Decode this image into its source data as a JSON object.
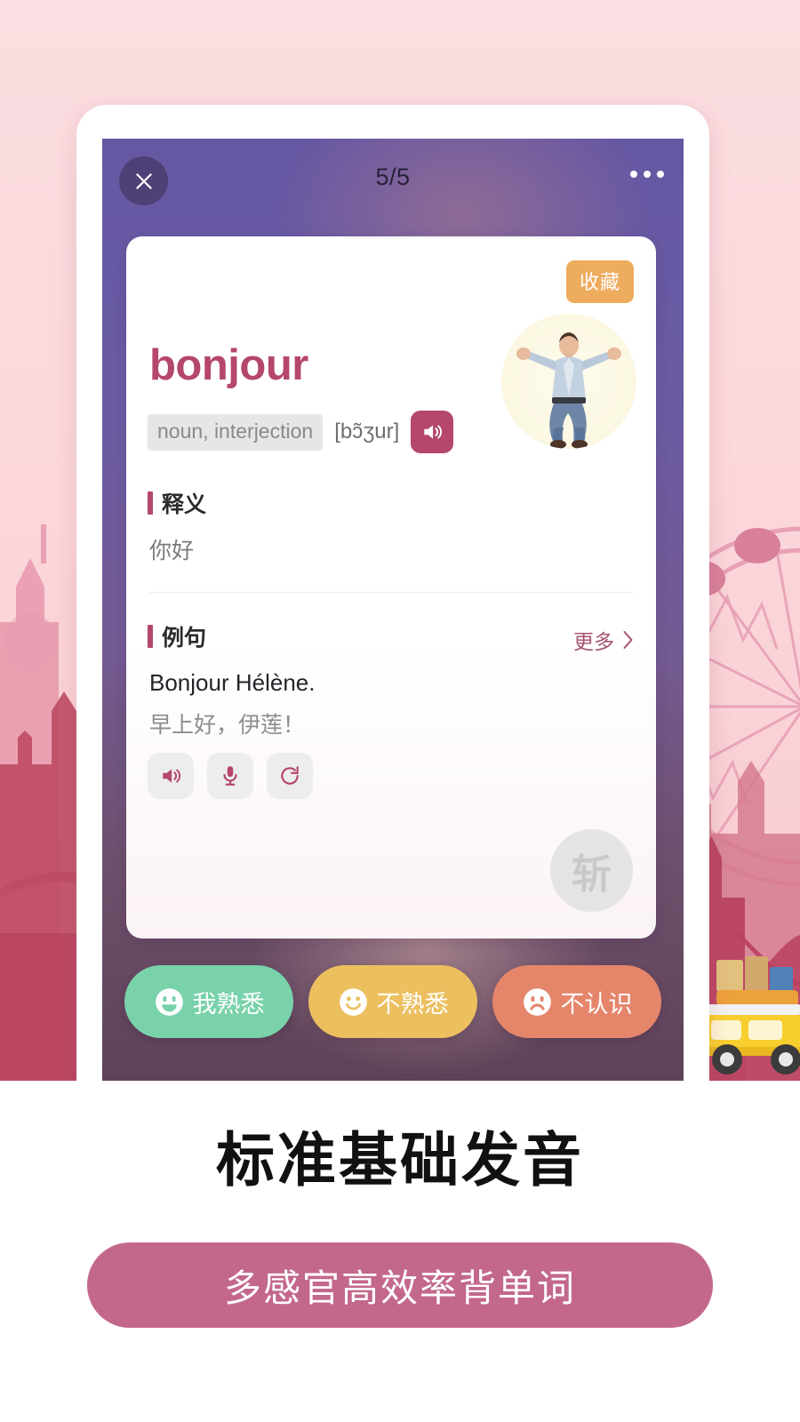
{
  "theme": {
    "page_bg": "#fbdee1",
    "screen_gradient_top": "#6657a3",
    "screen_gradient_bottom": "#5f4258",
    "accent": "#b5476a",
    "badge_orange": "#eeac5e",
    "cta_pink": "#c3688c"
  },
  "appbar": {
    "close_icon": "close-icon",
    "counter": "5/5",
    "more_icon": "more-options-icon"
  },
  "card": {
    "favorite_label": "收藏",
    "avatar_icon": "man-arms-open-illustration",
    "word": "bonjour",
    "part_of_speech": "noun, interjection",
    "phonetic": "[bɔ̃ʒur]",
    "speak_icon": "speaker-icon",
    "definition": {
      "heading": "释义",
      "text": "你好"
    },
    "examples": {
      "heading": "例句",
      "more_label": "更多",
      "more_icon": "chevron-right-icon",
      "source": "Bonjour Hélène.",
      "translation": "早上好，伊莲！",
      "actions": [
        {
          "name": "play-audio-button",
          "icon": "speaker-icon"
        },
        {
          "name": "record-button",
          "icon": "microphone-icon"
        },
        {
          "name": "replay-button",
          "icon": "refresh-icon"
        }
      ]
    },
    "watermark": "斩"
  },
  "answers": [
    {
      "label": "我熟悉",
      "icon": "smiley-grin-icon",
      "color": "#79d2aa",
      "name": "answer-familiar-button"
    },
    {
      "label": "不熟悉",
      "icon": "smiley-neutral-icon",
      "color": "#ecbf5f",
      "name": "answer-unfamiliar-button"
    },
    {
      "label": "不认识",
      "icon": "smiley-sad-icon",
      "color": "#e5866b",
      "name": "answer-unknown-button"
    }
  ],
  "promo": {
    "tagline": "标准基础发音",
    "cta": "多感官高效率背单词"
  }
}
